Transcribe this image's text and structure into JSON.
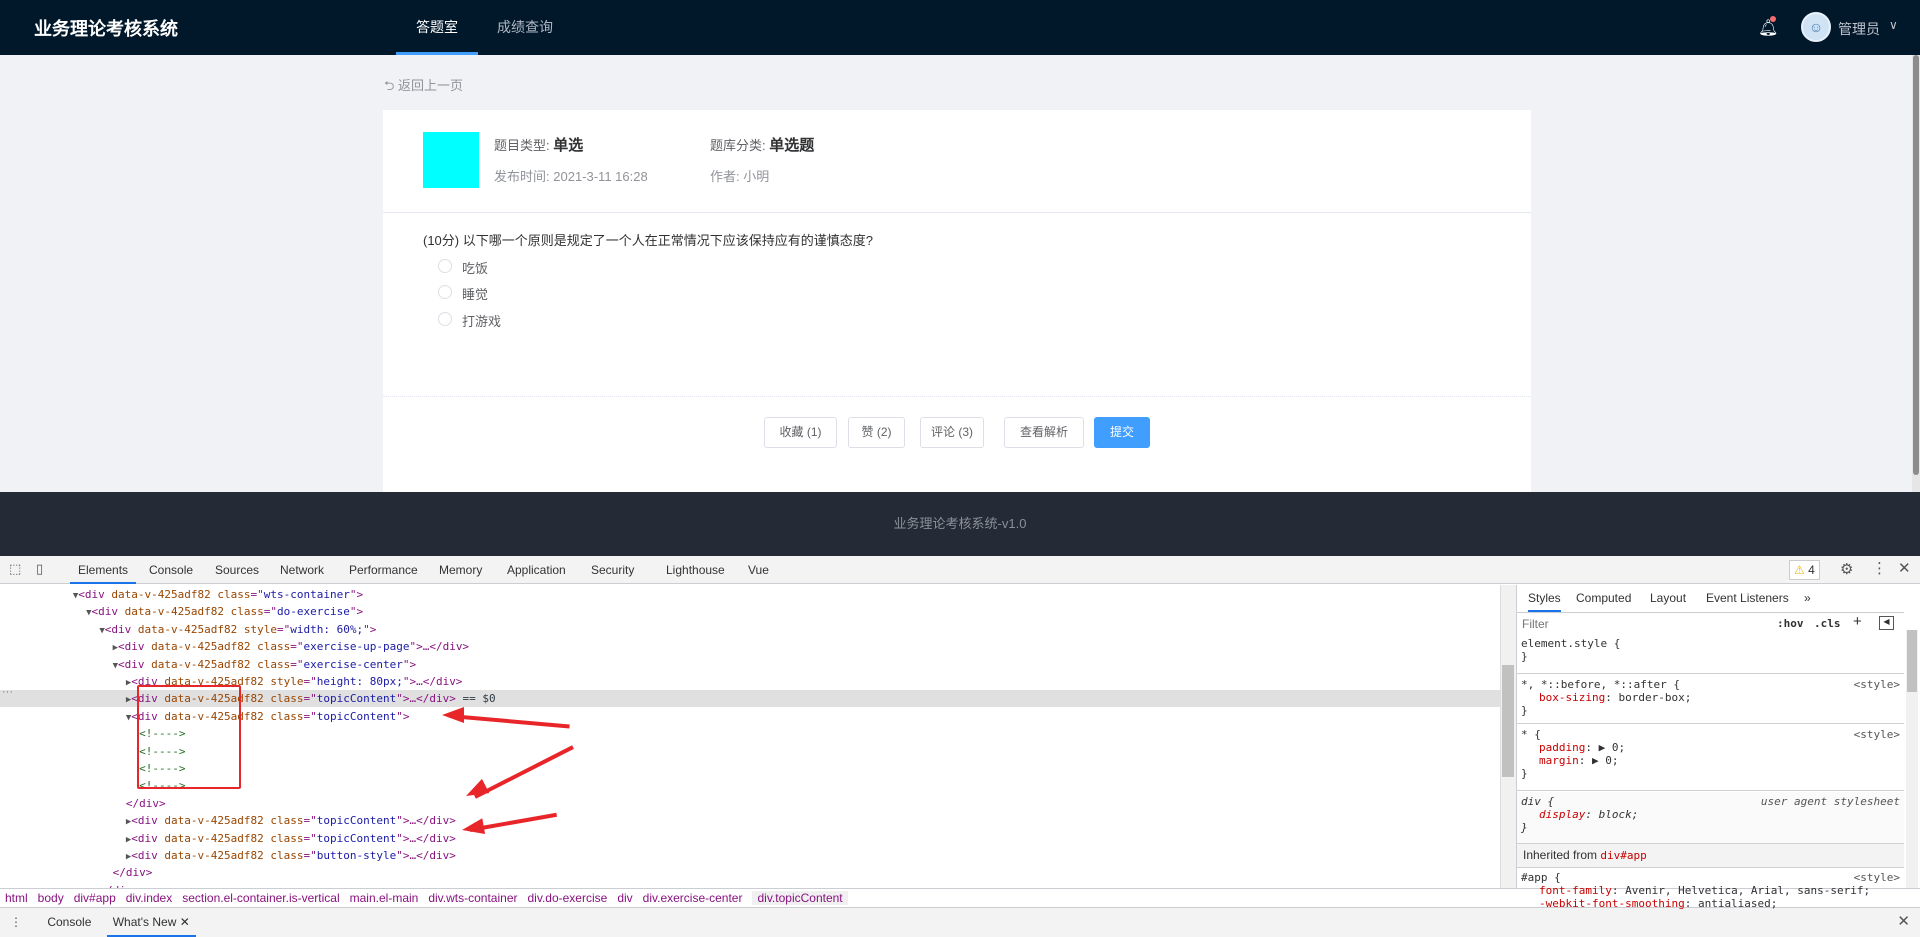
{
  "header": {
    "title": "业务理论考核系统",
    "nav": [
      "答题室",
      "成绩查询"
    ],
    "active_nav": 0,
    "bell_icon": "bell-icon",
    "user": "管理员",
    "user_chevron": "∨"
  },
  "page": {
    "back": "⮌ 返回上一页"
  },
  "question_meta": {
    "type_label": "题目类型:",
    "type_value": "单选",
    "bank_label": "题库分类:",
    "bank_value": "单选题",
    "time_label": "发布时间:",
    "time_value": "2021-3-11 16:28",
    "author_label": "作者:",
    "author_value": "小明",
    "thumb_color": "#00ffff"
  },
  "question": {
    "text": "(10分) 以下哪一个原则是规定了一个人在正常情况下应该保持应有的谨慎态度?",
    "options": [
      "吃饭",
      "睡觉",
      "打游戏"
    ]
  },
  "actions": {
    "favorite": "收藏 (1)",
    "like": "赞 (2)",
    "comment": "评论 (3)",
    "analysis": "查看解析",
    "submit": "提交"
  },
  "footer": {
    "text": "业务理论考核系统-v1.0"
  },
  "devtools": {
    "tabs": [
      "Elements",
      "Console",
      "Sources",
      "Network",
      "Performance",
      "Memory",
      "Application",
      "Security",
      "Lighthouse",
      "Vue"
    ],
    "warnings": "4",
    "rows": [
      {
        "t": "▼",
        "ind": 0,
        "tag": "div",
        "attrs": [
          [
            "data-v-425adf82",
            ""
          ],
          [
            "class",
            "wts-container"
          ]
        ],
        "tail": ""
      },
      {
        "t": "▼",
        "ind": 1,
        "tag": "div",
        "attrs": [
          [
            "data-v-425adf82",
            ""
          ],
          [
            "class",
            "do-exercise"
          ]
        ],
        "tail": ""
      },
      {
        "t": "▼",
        "ind": 2,
        "tag": "div",
        "attrs": [
          [
            "data-v-425adf82",
            ""
          ],
          [
            "style",
            "width: 60%;"
          ]
        ],
        "tail": ""
      },
      {
        "t": "▶",
        "ind": 3,
        "tag": "div",
        "attrs": [
          [
            "data-v-425adf82",
            ""
          ],
          [
            "class",
            "exercise-up-page"
          ]
        ],
        "tail": "…</div>"
      },
      {
        "t": "▼",
        "ind": 3,
        "tag": "div",
        "attrs": [
          [
            "data-v-425adf82",
            ""
          ],
          [
            "class",
            "exercise-center"
          ]
        ],
        "tail": ""
      },
      {
        "t": "▶",
        "ind": 4,
        "tag": "div",
        "attrs": [
          [
            "data-v-425adf82",
            ""
          ],
          [
            "style",
            "height: 80px;"
          ]
        ],
        "tail": "…</div>"
      },
      {
        "t": "▶",
        "ind": 4,
        "tag": "div",
        "attrs": [
          [
            "data-v-425adf82",
            ""
          ],
          [
            "class",
            "topicContent"
          ]
        ],
        "tail": "…</div>",
        "sel": true,
        "eq": " == $0"
      },
      {
        "t": "▼",
        "ind": 4,
        "tag": "div",
        "attrs": [
          [
            "data-v-425adf82",
            ""
          ],
          [
            "class",
            "topicContent"
          ]
        ],
        "tail": ""
      },
      {
        "comment": "<!---->",
        "ind": 5
      },
      {
        "comment": "<!---->",
        "ind": 5
      },
      {
        "comment": "<!---->",
        "ind": 5
      },
      {
        "comment": "<!---->",
        "ind": 5
      },
      {
        "close": "</div>",
        "ind": 4
      },
      {
        "t": "▶",
        "ind": 4,
        "tag": "div",
        "attrs": [
          [
            "data-v-425adf82",
            ""
          ],
          [
            "class",
            "topicContent"
          ]
        ],
        "tail": "…</div>"
      },
      {
        "t": "▶",
        "ind": 4,
        "tag": "div",
        "attrs": [
          [
            "data-v-425adf82",
            ""
          ],
          [
            "class",
            "topicContent"
          ]
        ],
        "tail": "…</div>"
      },
      {
        "t": "▶",
        "ind": 4,
        "tag": "div",
        "attrs": [
          [
            "data-v-425adf82",
            ""
          ],
          [
            "class",
            "button-style"
          ]
        ],
        "tail": "…</div>"
      },
      {
        "close": "</div>",
        "ind": 3
      },
      {
        "close": "</div>",
        "ind": 2
      }
    ],
    "style_tabs": [
      "Styles",
      "Computed",
      "Layout",
      "Event Listeners",
      "»"
    ],
    "filter_placeholder": "Filter",
    "hov": ":hov",
    "cls": ".cls",
    "rules": [
      {
        "sel": "element.style {",
        "lines": [],
        "src": ""
      },
      {
        "sel": "*, *::before, *::after {",
        "lines": [
          [
            "box-sizing",
            "border-box;"
          ]
        ],
        "src": "<style>"
      },
      {
        "sel": "* {",
        "lines": [
          [
            "padding",
            "▶ 0;"
          ],
          [
            "margin",
            "▶ 0;"
          ]
        ],
        "src": "<style>"
      },
      {
        "sel": "div {",
        "lines": [
          [
            "display",
            "block;"
          ]
        ],
        "src": "user agent stylesheet"
      }
    ],
    "inherited_label": "Inherited from",
    "inherited_from": "div#app",
    "app_rule": {
      "sel": "#app {",
      "src": "<style>",
      "lines": [
        [
          "font-family",
          "Avenir, Helvetica, Arial, sans-serif;"
        ],
        [
          "-webkit-font-smoothing",
          "antialiased;"
        ]
      ]
    },
    "breadcrumbs": [
      "html",
      "body",
      "div#app",
      "div.index",
      "section.el-container.is-vertical",
      "main.el-main",
      "div.wts-container",
      "div.do-exercise",
      "div",
      "div.exercise-center",
      "div.topicContent"
    ],
    "drawer_tabs": [
      "Console",
      "What's New"
    ]
  }
}
